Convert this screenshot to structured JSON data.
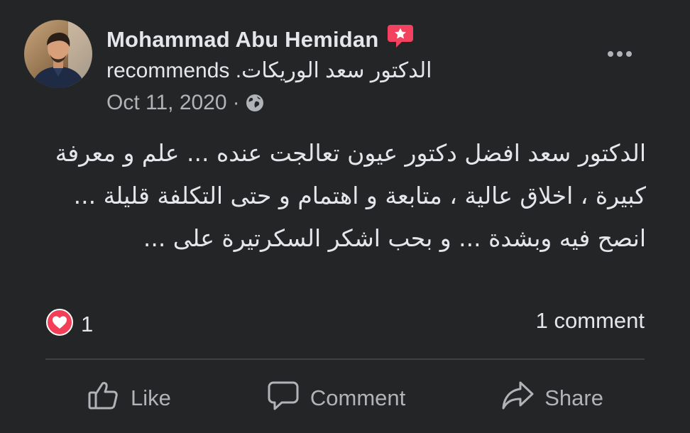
{
  "post": {
    "author": "Mohammad Abu Hemidan",
    "recommends_prefix": "recommends",
    "page_name": "الدكتور سعد الوريكات.",
    "date": "Oct 11, 2020",
    "separator": "·",
    "privacy_icon": "globe-icon",
    "badge_icon": "recommendation-star-icon",
    "body_text": "الدكتور سعد افضل دكتور عيون تعالجت عنده ... علم و معرفة كبيرة ، اخلاق عالية ، متابعة و اهتمام و حتى التكلفة قليلة ... انصح فيه وبشدة ... و بحب اشكر السكرتيرة على ..."
  },
  "stats": {
    "reaction_icon": "love-icon",
    "reaction_count": "1",
    "comment_count": "1 comment"
  },
  "actions": {
    "like": "Like",
    "comment": "Comment",
    "share": "Share"
  },
  "colors": {
    "background": "#242526",
    "text_primary": "#e4e6eb",
    "text_secondary": "#b0b3b8",
    "recommend_badge": "#f3425f",
    "love_reaction": "#f33e58"
  }
}
